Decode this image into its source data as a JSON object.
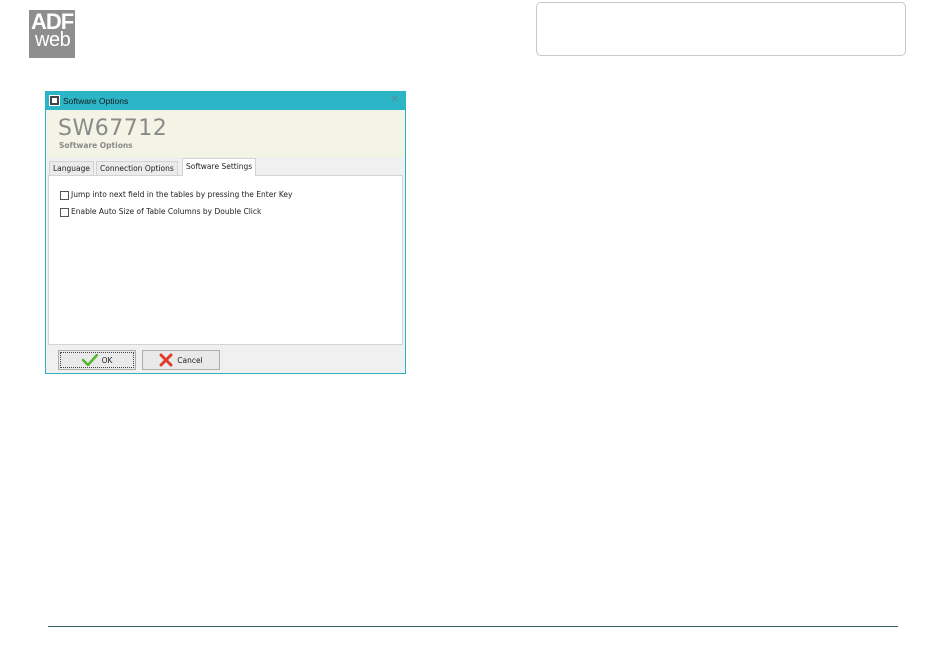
{
  "logo": {
    "line1": "ADF",
    "line2": "web"
  },
  "window": {
    "title": "Software Options",
    "close_glyph": "✕",
    "header_title": "SW67712",
    "header_subtitle": "Software Options"
  },
  "tabs": [
    {
      "label": "Language",
      "active": false
    },
    {
      "label": "Connection Options",
      "active": false
    },
    {
      "label": "Software Settings",
      "active": true
    }
  ],
  "settings": [
    {
      "label": "Jump into next field in the tables by pressing the Enter Key",
      "checked": false
    },
    {
      "label": "Enable Auto Size of Table Columns by Double Click",
      "checked": false
    }
  ],
  "buttons": {
    "ok_label": "OK",
    "cancel_label": "Cancel",
    "ok_icon": "checkmark-icon",
    "cancel_icon": "red-x-icon"
  },
  "colors": {
    "titlebar": "#2bb5c7",
    "header_bg": "#f3f3e6",
    "accent_line": "#2f5f63"
  }
}
